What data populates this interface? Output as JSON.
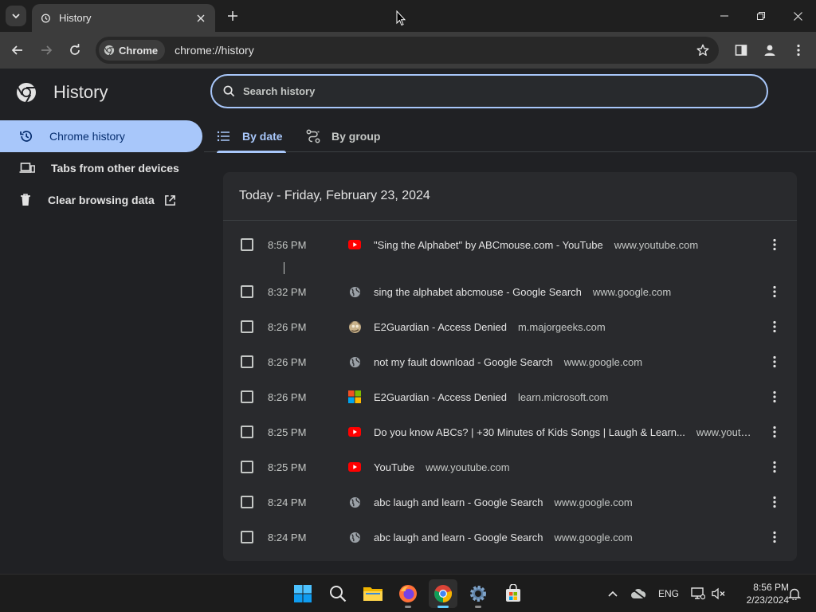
{
  "window": {
    "tab_title": "History"
  },
  "toolbar": {
    "chip_label": "Chrome",
    "url": "chrome://history"
  },
  "page": {
    "title": "History",
    "search_placeholder": "Search history"
  },
  "sidebar": {
    "items": [
      {
        "label": "Chrome history",
        "icon": "history-icon",
        "selected": true
      },
      {
        "label": "Tabs from other devices",
        "icon": "devices-icon",
        "selected": false
      },
      {
        "label": "Clear browsing data",
        "icon": "trash-icon",
        "selected": false,
        "external": true
      }
    ]
  },
  "view_tabs": [
    {
      "label": "By date",
      "icon": "list-icon",
      "active": true
    },
    {
      "label": "By group",
      "icon": "journeys-icon",
      "active": false
    }
  ],
  "history": {
    "day_header": "Today - Friday, February 23, 2024",
    "rows": [
      {
        "time": "8:56 PM",
        "favicon": "youtube-icon",
        "title": "\"Sing the Alphabet\" by ABCmouse.com - YouTube",
        "domain": "www.youtube.com"
      },
      {
        "time": "8:32 PM",
        "favicon": "globe-icon",
        "title": "sing the alphabet abcmouse - Google Search",
        "domain": "www.google.com"
      },
      {
        "time": "8:26 PM",
        "favicon": "majorgeeks-icon",
        "title": "E2Guardian - Access Denied",
        "domain": "m.majorgeeks.com"
      },
      {
        "time": "8:26 PM",
        "favicon": "globe-icon",
        "title": "not my fault download - Google Search",
        "domain": "www.google.com"
      },
      {
        "time": "8:26 PM",
        "favicon": "microsoft-icon",
        "title": "E2Guardian - Access Denied",
        "domain": "learn.microsoft.com"
      },
      {
        "time": "8:25 PM",
        "favicon": "youtube-icon",
        "title": "Do you know ABCs? | +30 Minutes of Kids Songs | Laugh & Learn...",
        "domain": "www.youtu..."
      },
      {
        "time": "8:25 PM",
        "favicon": "youtube-icon",
        "title": "YouTube",
        "domain": "www.youtube.com"
      },
      {
        "time": "8:24 PM",
        "favicon": "globe-icon",
        "title": "abc laugh and learn - Google Search",
        "domain": "www.google.com"
      },
      {
        "time": "8:24 PM",
        "favicon": "globe-icon",
        "title": "abc laugh and learn - Google Search",
        "domain": "www.google.com"
      }
    ]
  },
  "taskbar": {
    "language": "ENG",
    "clock_time": "8:56 PM",
    "clock_date": "2/23/2024"
  },
  "colors": {
    "accent": "#a8c7fa",
    "background": "#202124",
    "card": "#292a2d",
    "youtube_red": "#ff0000"
  }
}
